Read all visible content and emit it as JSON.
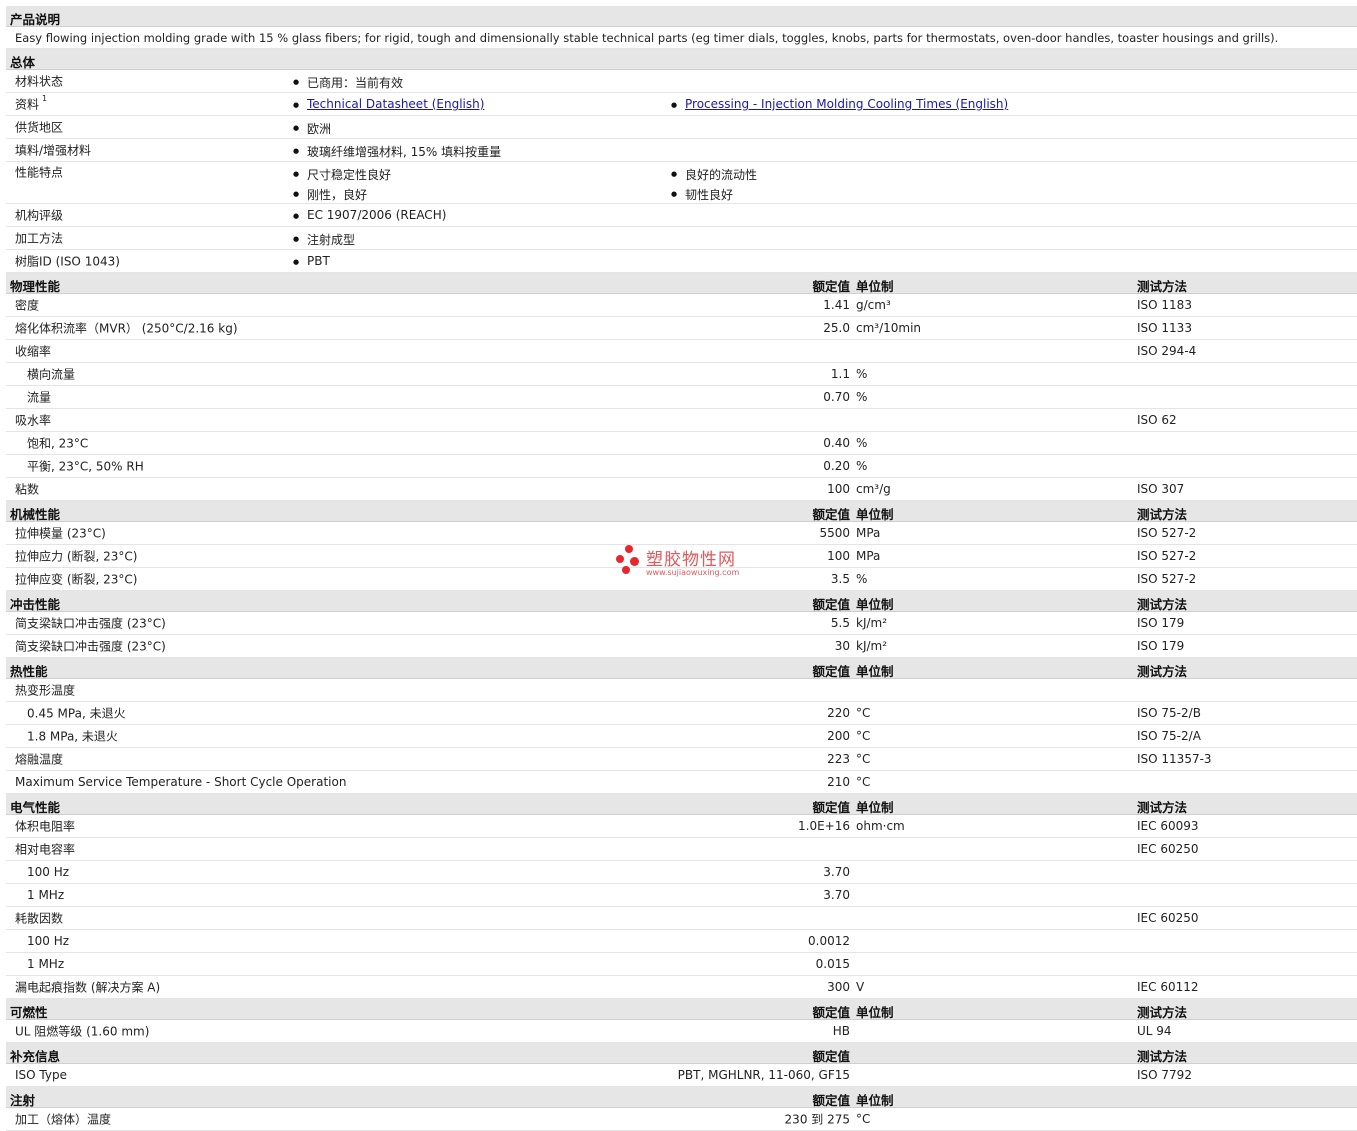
{
  "product_description": {
    "title": "产品说明",
    "text": "Easy flowing injection molding grade with 15 % glass fibers; for rigid, tough and dimensionally stable technical parts (eg timer dials, toggles, knobs, parts for thermostats, oven-door handles, toaster housings and grills)."
  },
  "general": {
    "title": "总体",
    "rows": [
      {
        "label": "材料状态",
        "col1": [
          "已商用：当前有效"
        ],
        "col2": []
      },
      {
        "label": "资料",
        "sup": "1",
        "links": [
          "Technical Datasheet (English)",
          "Processing - Injection Molding Cooling Times (English)"
        ]
      },
      {
        "label": "供货地区",
        "col1": [
          "欧洲"
        ],
        "col2": []
      },
      {
        "label": "填料/增强材料",
        "col1": [
          "玻璃纤维增强材料, 15% 填料按重量"
        ],
        "col2": []
      },
      {
        "label": "性能特点",
        "col1": [
          "尺寸稳定性良好",
          "刚性，良好"
        ],
        "col2": [
          "良好的流动性",
          "韧性良好"
        ]
      },
      {
        "label": "机构评级",
        "col1": [
          "EC 1907/2006 (REACH)"
        ],
        "col2": []
      },
      {
        "label": "加工方法",
        "col1": [
          "注射成型"
        ],
        "col2": []
      },
      {
        "label": "树脂ID (ISO 1043)",
        "col1": [
          "PBT"
        ],
        "col2": []
      }
    ]
  },
  "header_labels": {
    "value": "额定值",
    "unit": "单位制",
    "method": "测试方法"
  },
  "sections": [
    {
      "title": "物理性能",
      "headers": [
        "value",
        "unit",
        "method"
      ],
      "rows": [
        {
          "label": "密度",
          "value": "1.41",
          "unit": "g/cm³",
          "method": "ISO 1183"
        },
        {
          "label": "熔化体积流率（MVR） (250°C/2.16 kg)",
          "value": "25.0",
          "unit": "cm³/10min",
          "method": "ISO 1133"
        },
        {
          "label": "收缩率",
          "value": "",
          "unit": "",
          "method": "ISO 294-4"
        },
        {
          "label": "横向流量",
          "sub": true,
          "value": "1.1",
          "unit": "%",
          "method": ""
        },
        {
          "label": "流量",
          "sub": true,
          "value": "0.70",
          "unit": "%",
          "method": ""
        },
        {
          "label": "吸水率",
          "value": "",
          "unit": "",
          "method": "ISO 62"
        },
        {
          "label": "饱和, 23°C",
          "sub": true,
          "value": "0.40",
          "unit": "%",
          "method": ""
        },
        {
          "label": "平衡, 23°C, 50% RH",
          "sub": true,
          "value": "0.20",
          "unit": "%",
          "method": ""
        },
        {
          "label": "粘数",
          "value": "100",
          "unit": "cm³/g",
          "method": "ISO 307"
        }
      ]
    },
    {
      "title": "机械性能",
      "headers": [
        "value",
        "unit",
        "method"
      ],
      "rows": [
        {
          "label": "拉伸模量 (23°C)",
          "value": "5500",
          "unit": "MPa",
          "method": "ISO 527-2"
        },
        {
          "label": "拉伸应力 (断裂, 23°C)",
          "value": "100",
          "unit": "MPa",
          "method": "ISO 527-2"
        },
        {
          "label": "拉伸应变 (断裂, 23°C)",
          "value": "3.5",
          "unit": "%",
          "method": "ISO 527-2"
        }
      ]
    },
    {
      "title": "冲击性能",
      "headers": [
        "value",
        "unit",
        "method"
      ],
      "rows": [
        {
          "label": "简支梁缺口冲击强度 (23°C)",
          "value": "5.5",
          "unit": "kJ/m²",
          "method": "ISO 179"
        },
        {
          "label": "简支梁缺口冲击强度 (23°C)",
          "value": "30",
          "unit": "kJ/m²",
          "method": "ISO 179"
        }
      ]
    },
    {
      "title": "热性能",
      "headers": [
        "value",
        "unit",
        "method"
      ],
      "rows": [
        {
          "label": "热变形温度",
          "value": "",
          "unit": "",
          "method": ""
        },
        {
          "label": "0.45 MPa, 未退火",
          "sub": true,
          "value": "220",
          "unit": "°C",
          "method": "ISO 75-2/B"
        },
        {
          "label": "1.8 MPa, 未退火",
          "sub": true,
          "value": "200",
          "unit": "°C",
          "method": "ISO 75-2/A"
        },
        {
          "label": "熔融温度",
          "value": "223",
          "unit": "°C",
          "method": "ISO 11357-3"
        },
        {
          "label": "Maximum Service Temperature - Short Cycle Operation",
          "value": "210",
          "unit": "°C",
          "method": ""
        }
      ]
    },
    {
      "title": "电气性能",
      "headers": [
        "value",
        "unit",
        "method"
      ],
      "rows": [
        {
          "label": "体积电阻率",
          "value": "1.0E+16",
          "unit": "ohm·cm",
          "method": "IEC 60093"
        },
        {
          "label": "相对电容率",
          "value": "",
          "unit": "",
          "method": "IEC 60250"
        },
        {
          "label": "100 Hz",
          "sub": true,
          "value": "3.70",
          "unit": "",
          "method": ""
        },
        {
          "label": "1 MHz",
          "sub": true,
          "value": "3.70",
          "unit": "",
          "method": ""
        },
        {
          "label": "耗散因数",
          "value": "",
          "unit": "",
          "method": "IEC 60250"
        },
        {
          "label": "100 Hz",
          "sub": true,
          "value": "0.0012",
          "unit": "",
          "method": ""
        },
        {
          "label": "1 MHz",
          "sub": true,
          "value": "0.015",
          "unit": "",
          "method": ""
        },
        {
          "label": "漏电起痕指数 (解决方案 A)",
          "value": "300",
          "unit": "V",
          "method": "IEC 60112"
        }
      ]
    },
    {
      "title": "可燃性",
      "headers": [
        "value",
        "unit",
        "method"
      ],
      "rows": [
        {
          "label": "UL 阻燃等级 (1.60 mm)",
          "value": "HB",
          "unit": "",
          "method": "UL 94"
        }
      ]
    },
    {
      "title": "补充信息",
      "headers": [
        "value",
        "method"
      ],
      "rows": [
        {
          "label": "ISO Type",
          "value": "PBT, MGHLNR, 11-060, GF15",
          "unit": "",
          "method": "ISO 7792"
        }
      ]
    },
    {
      "title": "注射",
      "headers": [
        "value",
        "unit"
      ],
      "rows": [
        {
          "label": "加工（熔体）温度",
          "value": "230 到 275",
          "unit": "°C",
          "method": ""
        }
      ]
    }
  ],
  "watermark": {
    "title": "塑胶物性网",
    "url": "www.sujiaowuxing.com"
  },
  "colors": {
    "section_bg": "#e6e6e6",
    "link": "#1a1aa8",
    "watermark": "#e8262b"
  }
}
